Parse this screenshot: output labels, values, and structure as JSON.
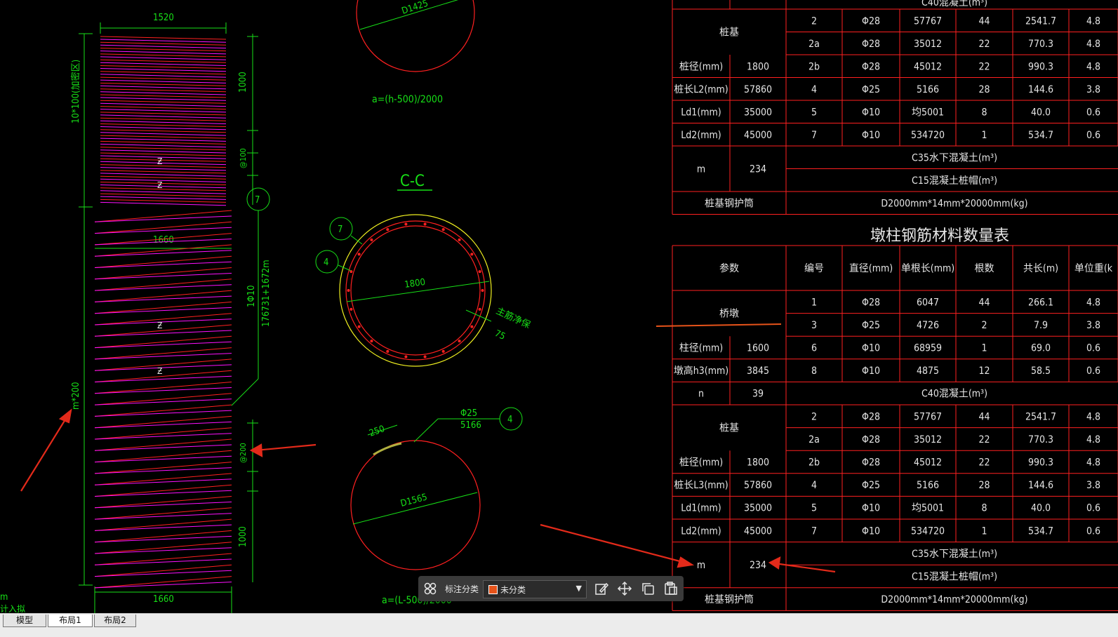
{
  "bottom_tabs": [
    "模型",
    "布局1",
    "布局2"
  ],
  "active_tab": "布局1",
  "left_edge_text": "m",
  "left_edge_text2": "计入拟",
  "drawing_left": {
    "dim_top_width": "1520",
    "dim_1000_top": "1000",
    "dim_10x100": "10*100(加密区)",
    "dim_at100": "@100",
    "mark_7": "7",
    "dim_1660_mid": "1660",
    "spiral_spec1": "1Φ10",
    "spiral_spec2": "176731+1672m",
    "dim_m200": "m*200",
    "dim_at200": "@200",
    "dim_1000_bottom": "1000",
    "dim_1660_bottom": "1660"
  },
  "drawing_mid": {
    "top_circle_dia": "D1425",
    "formula_top": "a=(h-500)/2000",
    "section_title": "C-C",
    "callout_7": "7",
    "callout_4": "4",
    "section_dia": "1800",
    "main_bar_label": "主筋净保",
    "cover_75": "75",
    "rebar_dia": "Φ25",
    "rebar_len": "5166",
    "callout_4b": "4",
    "dim_250": "250",
    "bottom_circle_dia": "D1565",
    "formula_bottom": "a=(L-500)/2000"
  },
  "table_top": {
    "partial_top_label": "C40混凝土(m³)",
    "rows": [
      {
        "c0": "桩基",
        "c2": "2",
        "c3": "Φ28",
        "c4": "57767",
        "c5": "44",
        "c6": "2541.7",
        "c7": "4.8"
      },
      {
        "c2": "2a",
        "c3": "Φ28",
        "c4": "35012",
        "c5": "22",
        "c6": "770.3",
        "c7": "4.8"
      },
      {
        "c0": "桩径(mm)",
        "c1": "1800",
        "c2": "2b",
        "c3": "Φ28",
        "c4": "45012",
        "c5": "22",
        "c6": "990.3",
        "c7": "4.8"
      },
      {
        "c0": "桩长L2(mm)",
        "c1": "57860",
        "c2": "4",
        "c3": "Φ25",
        "c4": "5166",
        "c5": "28",
        "c6": "144.6",
        "c7": "3.8"
      },
      {
        "c0": "Ld1(mm)",
        "c1": "35000",
        "c2": "5",
        "c3": "Φ10",
        "c4": "均5001",
        "c5": "8",
        "c6": "40.0",
        "c7": "0.6"
      },
      {
        "c0": "Ld2(mm)",
        "c1": "45000",
        "c2": "7",
        "c3": "Φ10",
        "c4": "534720",
        "c5": "1",
        "c6": "534.7",
        "c7": "0.6"
      }
    ],
    "m_label": "m",
    "m_value": "234",
    "concrete1": "C35水下混凝土(m³)",
    "concrete2": "C15混凝土桩帽(m³)",
    "casing_label": "桩基钢护筒",
    "casing_value": "D2000mm*14mm*20000mm(kg)"
  },
  "table_title": "墩柱钢筋材料数量表",
  "table_bottom": {
    "headers": [
      "参数",
      "编号",
      "直径(mm)",
      "单根长(mm)",
      "根数",
      "共长(m)",
      "单位重(k"
    ],
    "rows_pier": [
      {
        "c0": "桥墩",
        "c2": "1",
        "c3": "Φ28",
        "c4": "6047",
        "c5": "44",
        "c6": "266.1",
        "c7": "4.8"
      },
      {
        "c2": "3",
        "c3": "Φ25",
        "c4": "4726",
        "c5": "2",
        "c6": "7.9",
        "c7": "3.8"
      },
      {
        "c0": "柱径(mm)",
        "c1": "1600",
        "c2": "6",
        "c3": "Φ10",
        "c4": "68959",
        "c5": "1",
        "c6": "69.0",
        "c7": "0.6"
      },
      {
        "c0": "墩高h3(mm)",
        "c1": "3845",
        "c2": "8",
        "c3": "Φ10",
        "c4": "4875",
        "c5": "12",
        "c6": "58.5",
        "c7": "0.6"
      }
    ],
    "n_label": "n",
    "n_value": "39",
    "concrete_c40": "C40混凝土(m³)",
    "rows_pile": [
      {
        "c0": "桩基",
        "c2": "2",
        "c3": "Φ28",
        "c4": "57767",
        "c5": "44",
        "c6": "2541.7",
        "c7": "4.8"
      },
      {
        "c2": "2a",
        "c3": "Φ28",
        "c4": "35012",
        "c5": "22",
        "c6": "770.3",
        "c7": "4.8"
      },
      {
        "c0": "桩径(mm)",
        "c1": "1800",
        "c2": "2b",
        "c3": "Φ28",
        "c4": "45012",
        "c5": "22",
        "c6": "990.3",
        "c7": "4.8"
      },
      {
        "c0": "桩长L3(mm)",
        "c1": "57860",
        "c2": "4",
        "c3": "Φ25",
        "c4": "5166",
        "c5": "28",
        "c6": "144.6",
        "c7": "3.8"
      },
      {
        "c0": "Ld1(mm)",
        "c1": "35000",
        "c2": "5",
        "c3": "Φ10",
        "c4": "均5001",
        "c5": "8",
        "c6": "40.0",
        "c7": "0.6"
      },
      {
        "c0": "Ld2(mm)",
        "c1": "45000",
        "c2": "7",
        "c3": "Φ10",
        "c4": "534720",
        "c5": "1",
        "c6": "534.7",
        "c7": "0.6"
      }
    ],
    "m_label": "m",
    "m_value": "234",
    "concrete1": "C35水下混凝土(m³)",
    "concrete2": "C15混凝土桩帽(m³)",
    "casing_label": "桩基钢护筒",
    "casing_value": "D2000mm*14mm*20000mm(kg)"
  },
  "annotation_toolbar": {
    "label": "标注分类",
    "selected": "未分类",
    "swatch_color": "#e6531a"
  },
  "colors": {
    "cad_green": "#17e017",
    "cad_red": "#ff2020",
    "cad_magenta": "#ff10ff",
    "cad_yellow": "#f0f020",
    "arrow_red": "#e32a1a"
  }
}
